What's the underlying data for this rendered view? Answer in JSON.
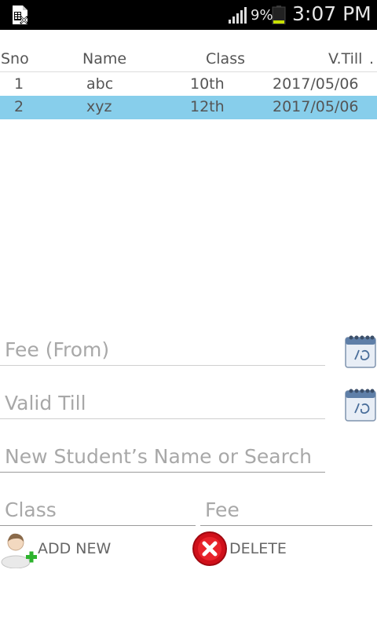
{
  "status_bar": {
    "battery_percent": "9%",
    "time": "3:07 PM",
    "left_icon": "excel-file-icon",
    "signal_icon": "signal-icon",
    "battery_icon": "battery-icon"
  },
  "table": {
    "columns": [
      "Sno",
      "Name",
      "Class",
      "V.Till",
      "."
    ],
    "rows": [
      {
        "sno": "1",
        "name": "abc",
        "class": "10th",
        "valid_till": "2017/05/06"
      },
      {
        "sno": "2",
        "name": "xyz",
        "class": "12th",
        "valid_till": "2017/05/06"
      }
    ],
    "selected_row_color": "#87ceeb"
  },
  "form": {
    "fee_from_placeholder": "Fee (From)",
    "valid_till_placeholder": "Valid Till",
    "name_placeholder": "New Student’s Name or Search",
    "class_placeholder": "Class",
    "fee_placeholder": "Fee",
    "calendar_icon": "calendar-icon"
  },
  "actions": {
    "add_label": "ADD NEW",
    "delete_label": "DELETE",
    "add_icon": "add-user-icon",
    "delete_icon": "delete-icon",
    "delete_color": "#d0101a"
  }
}
